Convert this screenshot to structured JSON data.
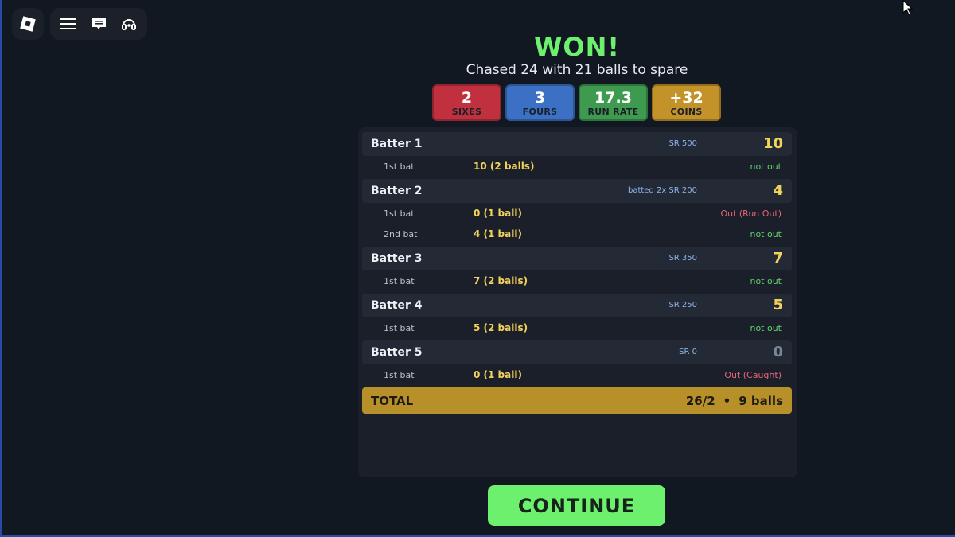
{
  "result": {
    "title": "WON!",
    "subtitle": "Chased 24 with 21 balls to spare"
  },
  "stats": [
    {
      "value": "2",
      "label": "SIXES",
      "color": "#c0303f"
    },
    {
      "value": "3",
      "label": "FOURS",
      "color": "#3c70c4"
    },
    {
      "value": "17.3",
      "label": "RUN RATE",
      "color": "#3e9a4e"
    },
    {
      "value": "+32",
      "label": "COINS",
      "color": "#c3932a"
    }
  ],
  "batters": [
    {
      "name": "Batter 1",
      "meta": "SR 500",
      "score": "10",
      "innings": [
        {
          "label": "1st bat",
          "runs": "10  (2 balls)",
          "status": "not out"
        }
      ]
    },
    {
      "name": "Batter 2",
      "meta": "batted 2x   SR 200",
      "score": "4",
      "innings": [
        {
          "label": "1st bat",
          "runs": "0  (1 ball)",
          "status": "Out (Run Out)"
        },
        {
          "label": "2nd bat",
          "runs": "4  (1 ball)",
          "status": "not out"
        }
      ]
    },
    {
      "name": "Batter 3",
      "meta": "SR 350",
      "score": "7",
      "innings": [
        {
          "label": "1st bat",
          "runs": "7  (2 balls)",
          "status": "not out"
        }
      ]
    },
    {
      "name": "Batter 4",
      "meta": "SR 250",
      "score": "5",
      "innings": [
        {
          "label": "1st bat",
          "runs": "5  (2 balls)",
          "status": "not out"
        }
      ]
    },
    {
      "name": "Batter 5",
      "meta": "SR 0",
      "score": "0",
      "innings": [
        {
          "label": "1st bat",
          "runs": "0  (1 ball)",
          "status": "Out (Caught)"
        }
      ]
    }
  ],
  "total": {
    "label": "TOTAL",
    "score": "26/2",
    "separator": "•",
    "balls": "9 balls"
  },
  "continue_label": "CONTINUE",
  "colors": {
    "win": "#6cf06e",
    "score": "#f2d35a",
    "not_out": "#5fd06a",
    "out": "#e8647a",
    "total_bar": "#b8902a"
  },
  "icons": {
    "logo": "roblox-logo-icon",
    "menu": "menu-icon",
    "chat": "chat-icon",
    "headset": "headset-icon",
    "cursor": "mouse-cursor-icon"
  }
}
